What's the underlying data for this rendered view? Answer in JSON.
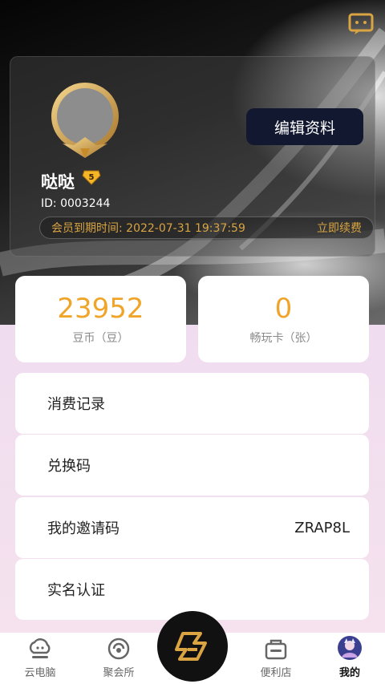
{
  "header": {
    "message_icon": "message-icon"
  },
  "profile": {
    "avatar_icon": "avatar-frame",
    "username": "哒哒",
    "vip_level": "5",
    "user_id": "ID: 0003244",
    "edit_label": "编辑资料",
    "expiry_text": "会员到期时间: 2022-07-31 19:37:59",
    "renew_label": "立即续费"
  },
  "stats": [
    {
      "value": "23952",
      "label": "豆币（豆）"
    },
    {
      "value": "0",
      "label": "畅玩卡（张）"
    }
  ],
  "menu": [
    {
      "label": "消费记录",
      "value": ""
    },
    {
      "label": "兑换码",
      "value": ""
    },
    {
      "label": "我的邀请码",
      "value": "ZRAP8L"
    },
    {
      "label": "实名认证",
      "value": ""
    }
  ],
  "tabs": [
    {
      "label": "云电脑",
      "icon": "cloud-pc-icon"
    },
    {
      "label": "聚会所",
      "icon": "club-icon"
    },
    {
      "label": "",
      "icon": "center-logo-icon"
    },
    {
      "label": "便利店",
      "icon": "store-icon"
    },
    {
      "label": "我的",
      "icon": "profile-avatar-icon"
    }
  ],
  "colors": {
    "accent": "#f0a52a",
    "gold": "#d9a441",
    "edit_button": "#121830"
  }
}
